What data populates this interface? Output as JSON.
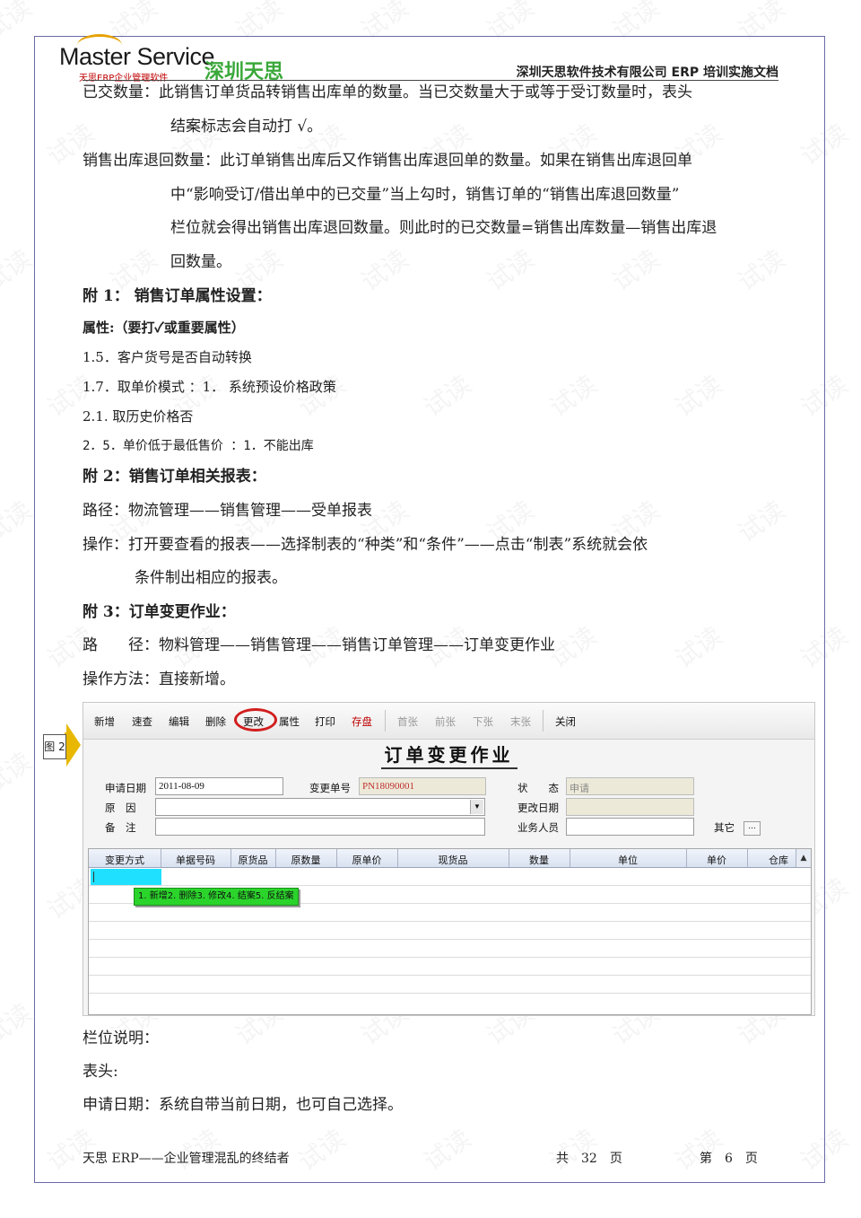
{
  "header": {
    "logo_brand": "Master Service",
    "logo_sub": "天思ERP企业管理软件",
    "logo_cn": "深圳天思",
    "doc_title": "深圳天思软件技术有限公司 ERP 培训实施文档"
  },
  "body": {
    "p1_label": "已交数量：",
    "p1_line1": "此销售订单货品转销售出库单的数量。当已交数量大于或等于受订数量时，表头",
    "p1_line2": "结案标志会自动打 √。",
    "p2_label": "销售出库退回数量：",
    "p2_line1": "此订单销售出库后又作销售出库退回单的数量。如果在销售出库退回单",
    "p2_line2": "中“影响受订/借出单中的已交量”当上勾时，销售订单的“销售出库退回数量”",
    "p2_line3": "栏位就会得出销售出库退回数量。则此时的已交数量=销售出库数量—销售出库退",
    "p2_line4": "回数量。",
    "appendix1_title": "附 1：  销售订单属性设置：",
    "attr_title": "属性:（要打✓或重要属性）",
    "attr_1": "1.5．客户货号是否自动转换",
    "attr_2": "1.7．取单价模式 ：1． 系统预设价格政策",
    "attr_3": "2.1. 取历史价格否",
    "attr_4": "2．5．单价低于最低售价 ：1．不能出库",
    "appendix2_title": "附 2：销售订单相关报表：",
    "path2": "路径：物流管理——销售管理——受单报表",
    "op2_line1": "操作：打开要查看的报表——选择制表的“种类”和“条件”——点击“制表”系统就会依",
    "op2_line2": "条件制出相应的报表。",
    "appendix3_title": "附 3：订单变更作业：",
    "path3_label": "路　　径：",
    "path3": "物料管理——销售管理——销售订单管理——订单变更作业",
    "op3": "操作方法：直接新增。",
    "fig_label": "图 2",
    "field_desc": "栏位说明：",
    "header_label": "表头:",
    "apply_date": "申请日期：系统自带当前日期，也可自己选择。"
  },
  "screenshot": {
    "toolbar": [
      "新增",
      "速查",
      "编辑",
      "删除",
      "更改",
      "属性",
      "打印",
      "存盘",
      "首张",
      "前张",
      "下张",
      "末张",
      "关闭"
    ],
    "form_title": "订单变更作业",
    "labels": {
      "apply_date": "申请日期",
      "reason": "原　因",
      "remark": "备　注",
      "change_no": "变更单号",
      "status": "状　　态",
      "change_date": "更改日期",
      "salesman": "业务人员",
      "other": "其它"
    },
    "values": {
      "apply_date": "2011-08-09",
      "change_no": "PN18090001",
      "status": "申请"
    },
    "grid_headers": [
      "变更方式",
      "单据号码",
      "原货品",
      "原数量",
      "原单价",
      "现货品",
      "数量",
      "单位",
      "单价",
      "仓库"
    ],
    "tooltip": "1. 新增2. 删除3. 修改4. 结案5. 反结案"
  },
  "footer": {
    "left": "天思 ERP——企业管理混乱的终结者",
    "total": "共　32　页",
    "page": "第　6　页"
  },
  "watermark": "试读"
}
